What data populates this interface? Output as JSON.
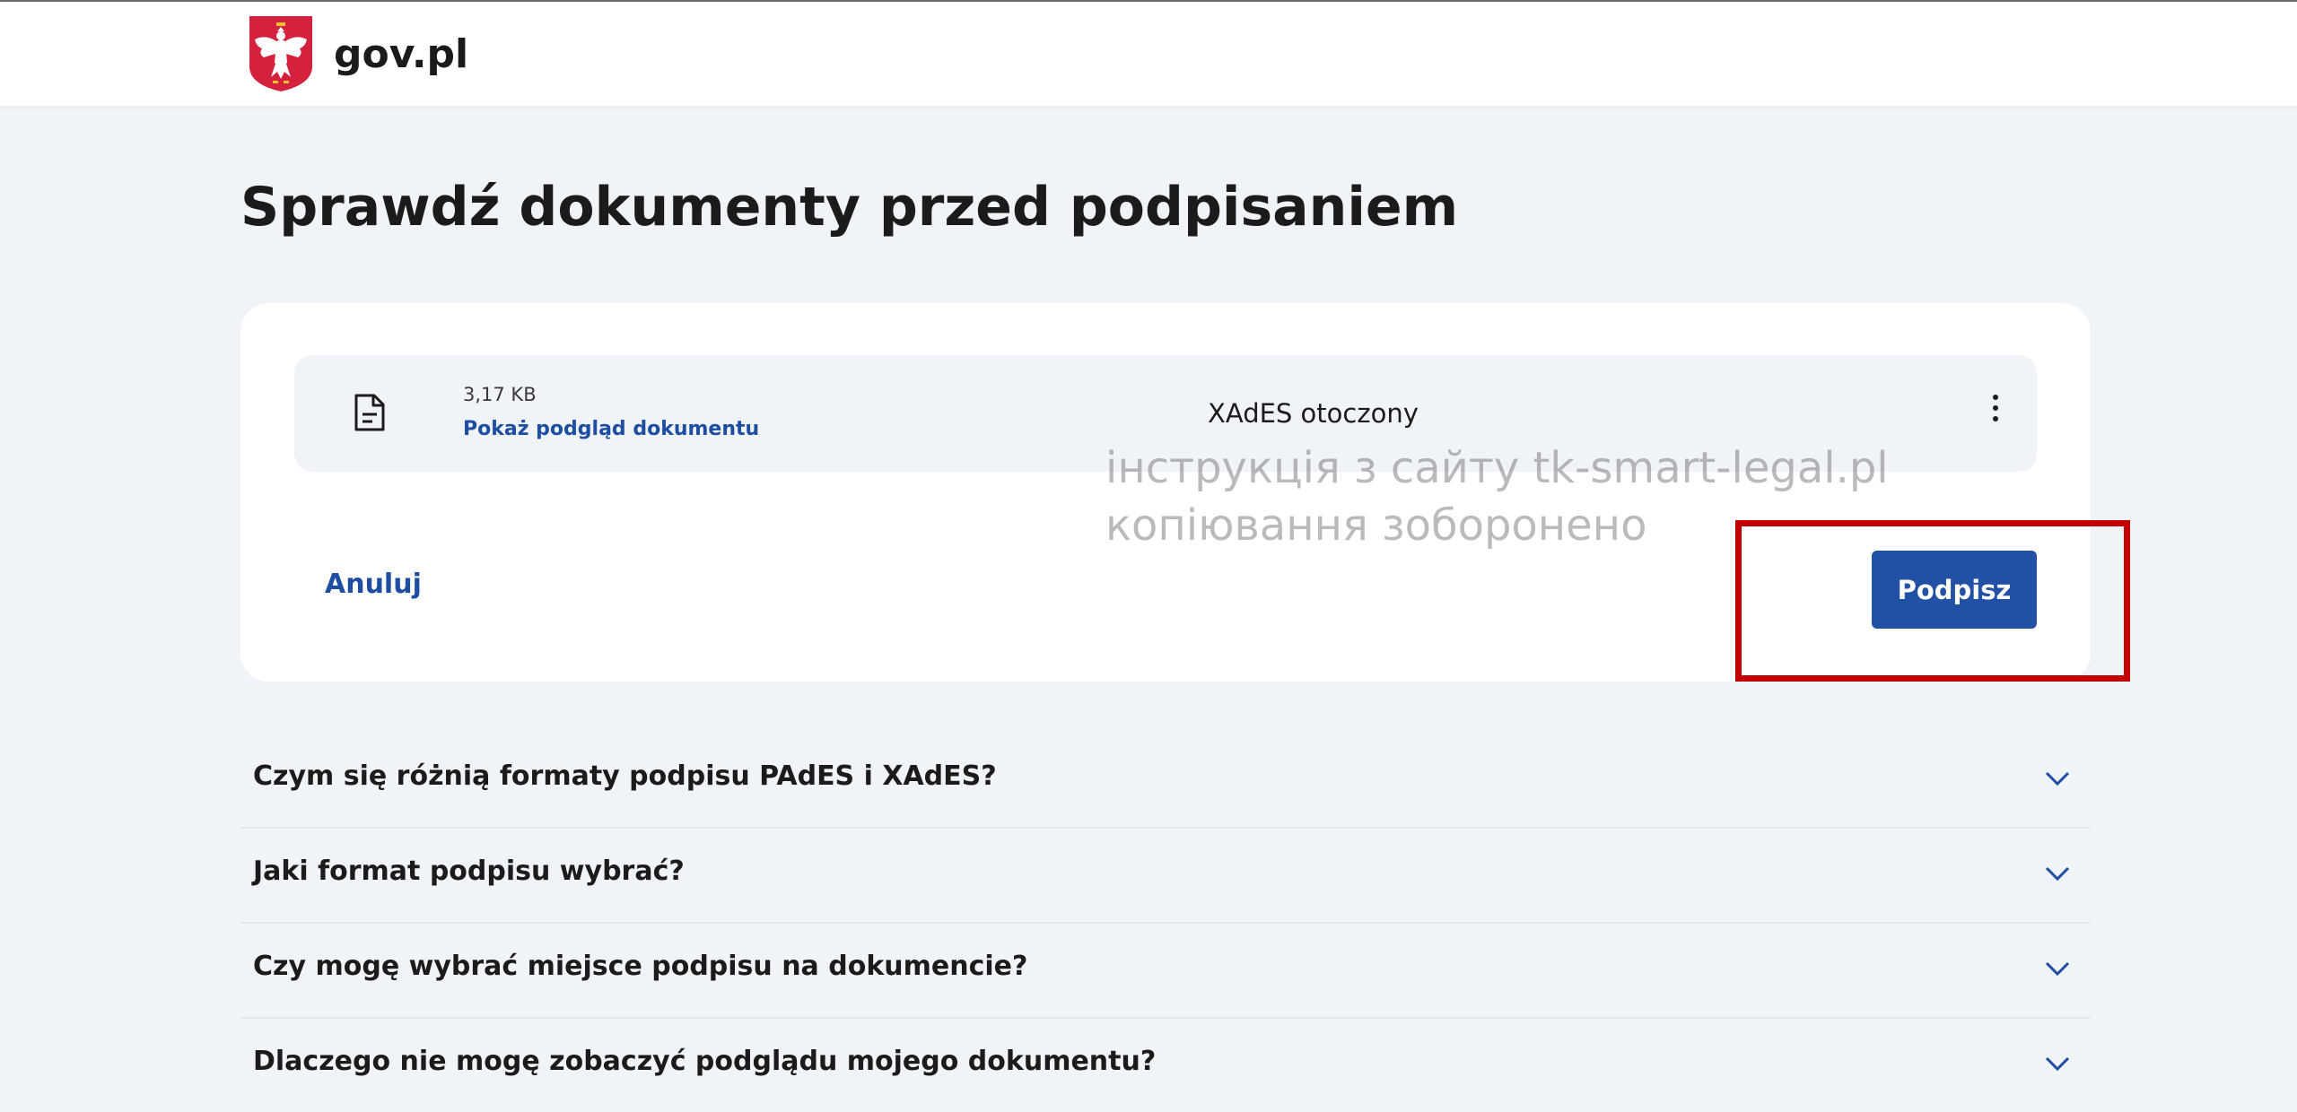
{
  "header": {
    "logo_text": "gov.pl",
    "emblem_icon": "polish-eagle-emblem-icon"
  },
  "main": {
    "title": "Sprawdź dokumenty przed podpisaniem"
  },
  "document": {
    "icon": "document-icon",
    "size": "3,17 KB",
    "preview_link": "Pokaż podgląd dokumentu",
    "format": "XAdES otoczony",
    "menu_icon": "more-vertical-icon"
  },
  "actions": {
    "cancel_label": "Anuluj",
    "sign_label": "Podpisz"
  },
  "watermark": {
    "line1": "інструкція з сайту tk-smart-legal.pl",
    "line2": "копіювання зоборонено"
  },
  "faq": [
    {
      "question": "Czym się różnią formaty podpisu PAdES i XAdES?",
      "icon": "chevron-down-icon"
    },
    {
      "question": "Jaki format podpisu wybrać?",
      "icon": "chevron-down-icon"
    },
    {
      "question": "Czy mogę wybrać miejsce podpisu na dokumencie?",
      "icon": "chevron-down-icon"
    },
    {
      "question": "Dlaczego nie mogę zobaczyć podglądu mojego dokumentu?",
      "icon": "chevron-down-icon"
    }
  ],
  "colors": {
    "background": "#f0f3f8",
    "primary": "#2150a4",
    "link": "#1e4ea1",
    "highlight": "#c30000",
    "emblem_red": "#d4213d"
  }
}
